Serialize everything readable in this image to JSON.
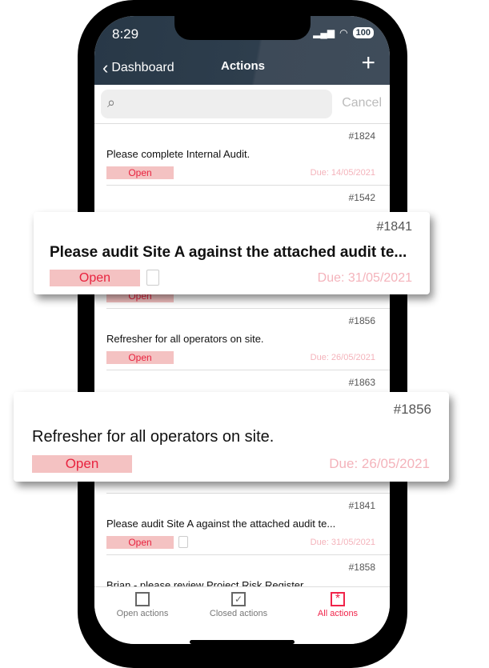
{
  "status": {
    "time": "8:29",
    "battery": "100"
  },
  "nav": {
    "back": "Dashboard",
    "title": "Actions",
    "add": "+"
  },
  "search": {
    "placeholder": "",
    "cancel": "Cancel"
  },
  "items": [
    {
      "num": "#1824",
      "title": "Please complete Internal Audit.",
      "status": "Open",
      "due": "Due: 14/05/2021"
    },
    {
      "num": "#1542",
      "title": "",
      "status": "",
      "due": ""
    },
    {
      "num": "",
      "title": "",
      "status": "Open",
      "due": ""
    },
    {
      "num": "#1856",
      "title": "Refresher for all operators on site.",
      "status": "Open",
      "due": "Due: 26/05/2021"
    },
    {
      "num": "#1863",
      "title": "",
      "status": "",
      "due": ""
    },
    {
      "num": "",
      "title": "",
      "status": "",
      "due": ""
    },
    {
      "num": "#1841",
      "title": "Please audit Site A against the attached audit te...",
      "status": "Open",
      "due": "Due: 31/05/2021"
    },
    {
      "num": "#1858",
      "title": "Brian - please review Project Risk Register.",
      "status": "",
      "due": ""
    }
  ],
  "cards": [
    {
      "num": "#1841",
      "title": "Please audit Site A against the attached audit te...",
      "status": "Open",
      "due": "Due: 31/05/2021"
    },
    {
      "num": "#1856",
      "title": "Refresher for all operators on site.",
      "status": "Open",
      "due": "Due: 26/05/2021"
    }
  ],
  "tabs": [
    {
      "label": "Open actions"
    },
    {
      "label": "Closed actions"
    },
    {
      "label": "All actions",
      "active": true
    }
  ],
  "colors": {
    "header": "#283847",
    "accent": "#f0244a",
    "badge": "#f4c2c2"
  }
}
